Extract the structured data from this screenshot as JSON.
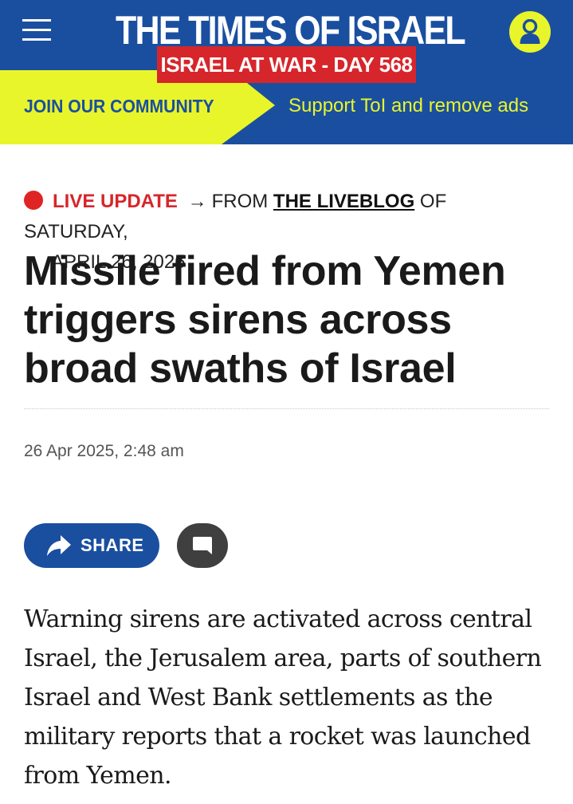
{
  "header": {
    "logo_text": "THE TIMES OF ISRAEL",
    "war_badge": "ISRAEL AT WAR - DAY 568",
    "menu_icon": "hamburger-menu-icon",
    "account_icon": "user-account-icon"
  },
  "promo": {
    "join_label": "JOIN OUR COMMUNITY",
    "support_label": "Support ToI and remove ads"
  },
  "article": {
    "live_label": "LIVE UPDATE",
    "arrow": "→",
    "from_text": "FROM",
    "liveblog_link": "THE LIVEBLOG",
    "of_text": "OF SATURDAY,",
    "date_text": "APRIL 26, 2025",
    "headline": "Missile fired from Yemen triggers sirens across broad swaths of Israel",
    "timestamp": "26 Apr 2025, 2:48 am",
    "share_label": "SHARE",
    "body": "Warning sirens are activated across central Israel, the Jerusalem area, parts of southern Israel and West Bank settlements as the military reports that a rocket was launched from Yemen."
  },
  "colors": {
    "brand_blue": "#1a4fa0",
    "accent_yellow": "#e9f52b",
    "alert_red": "#d6262b",
    "live_dot": "#e02424",
    "comment_button": "#3f3f3f"
  }
}
